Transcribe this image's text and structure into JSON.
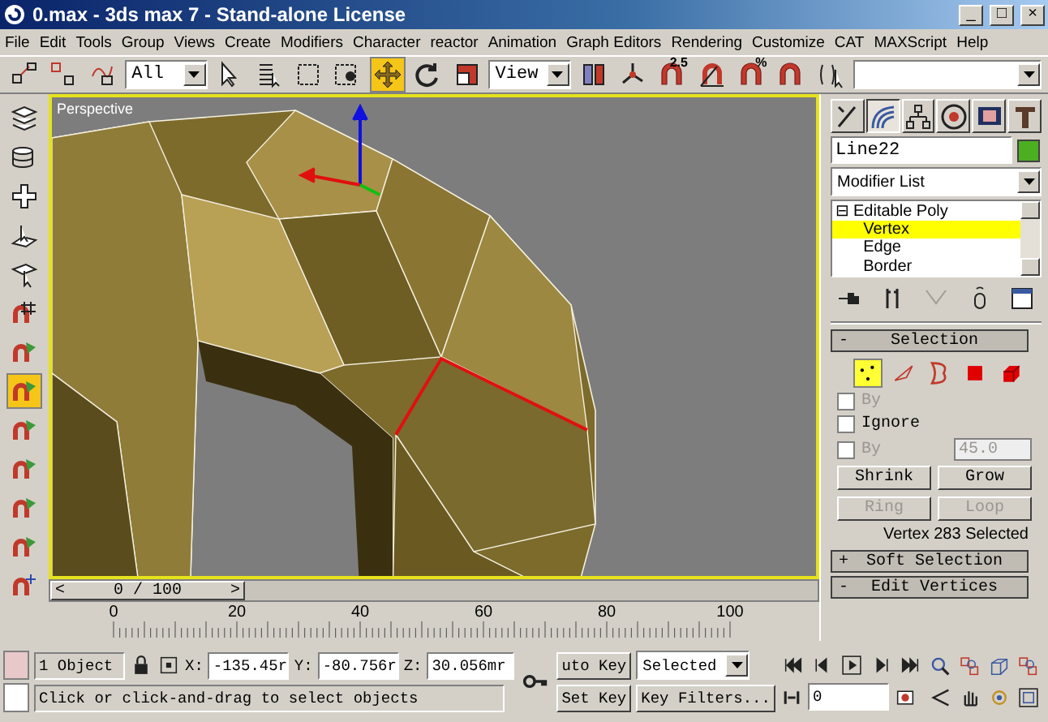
{
  "window": {
    "title": "0.max - 3ds max 7  - Stand-alone License"
  },
  "window_buttons": [
    "_",
    "□",
    "×"
  ],
  "menu": [
    "File",
    "Edit",
    "Tools",
    "Group",
    "Views",
    "Create",
    "Modifiers",
    "Character",
    "reactor",
    "Animation",
    "Graph Editors",
    "Rendering",
    "Customize",
    "CAT",
    "MAXScript",
    "Help"
  ],
  "main_toolbar": [
    {
      "kind": "tool",
      "selected": false
    },
    {
      "kind": "tool",
      "selected": false
    },
    {
      "kind": "tool",
      "selected": false
    },
    {
      "kind": "dropdown",
      "value": "All"
    },
    {
      "kind": "tool",
      "selected": false
    },
    {
      "kind": "tool",
      "selected": false
    },
    {
      "kind": "tool",
      "selected": false
    },
    {
      "kind": "tool",
      "selected": false
    },
    {
      "kind": "tool",
      "selected": true
    },
    {
      "kind": "tool",
      "selected": false
    },
    {
      "kind": "tool",
      "selected": false
    },
    {
      "kind": "dropdown",
      "value": "View"
    },
    {
      "kind": "tool",
      "selected": false
    },
    {
      "kind": "tool",
      "selected": false
    },
    {
      "kind": "tool",
      "selected": false,
      "badge": "2.5"
    },
    {
      "kind": "tool",
      "selected": false
    },
    {
      "kind": "tool",
      "selected": false,
      "badge": "%"
    },
    {
      "kind": "tool",
      "selected": false
    },
    {
      "kind": "tool",
      "selected": false
    },
    {
      "kind": "dropdown"
    }
  ],
  "left_toolbar": [
    {
      "selected": false
    },
    {
      "selected": false
    },
    {
      "selected": false
    },
    {
      "selected": false
    },
    {
      "selected": false
    },
    {
      "selected": false
    },
    {
      "selected": false
    },
    {
      "selected": true
    },
    {
      "selected": false
    },
    {
      "selected": false
    },
    {
      "selected": false
    },
    {
      "selected": false
    },
    {
      "selected": false
    }
  ],
  "viewport": {
    "label": "Perspective"
  },
  "command_panel": {
    "tabs": [
      {
        "selected": false
      },
      {
        "selected": true
      },
      {
        "selected": false
      },
      {
        "selected": false
      },
      {
        "selected": false
      },
      {
        "selected": false
      }
    ],
    "object": {
      "name": "Line22",
      "color": "#4caf22"
    },
    "modifier_list": "Modifier List",
    "stack": [
      {
        "label": "Editable Poly",
        "sign": "⊟",
        "selected": false,
        "children": [
          {
            "label": "Vertex",
            "selected": true
          },
          {
            "label": "Edge",
            "selected": false
          },
          {
            "label": "Border",
            "selected": false
          }
        ]
      }
    ],
    "stack_tools": [
      {
        "disabled": false
      },
      {
        "disabled": false
      },
      {
        "disabled": true
      },
      {
        "disabled": false
      },
      {
        "disabled": false
      }
    ],
    "rollouts": [
      {
        "sign": "-",
        "title": "Selection",
        "kind": "selection"
      },
      {
        "sign": "+",
        "title": "Soft Selection",
        "kind": "header"
      },
      {
        "sign": "-",
        "title": "Edit Vertices",
        "kind": "header"
      }
    ],
    "subobjects": [
      {
        "selected": true
      },
      {
        "selected": false
      },
      {
        "selected": false
      },
      {
        "selected": false
      },
      {
        "selected": false
      }
    ],
    "options": [
      {
        "label": "By",
        "checked": false,
        "disabled": true
      },
      {
        "label": "Ignore",
        "checked": false,
        "disabled": false
      },
      {
        "label": "By",
        "checked": false,
        "disabled": true,
        "value": "45.0"
      }
    ],
    "buttons": [
      {
        "label": "Shrink",
        "disabled": false
      },
      {
        "label": "Grow",
        "disabled": false
      },
      {
        "label": "Ring",
        "disabled": true
      },
      {
        "label": "Loop",
        "disabled": true
      }
    ],
    "selection_info": "Vertex 283 Selected"
  },
  "time_slider": {
    "prev": "<",
    "label": "0 / 100",
    "next": ">",
    "level": 0
  },
  "ruler": [
    "0",
    "20",
    "40",
    "60",
    "80",
    "100"
  ],
  "status": {
    "selection": "1 Object",
    "x_label": "X:",
    "x": "-135.45r",
    "y_label": "Y:",
    "y": "-80.756r",
    "z_label": "Z:",
    "z": "30.056mr",
    "prompt": "Click or click-and-drag to select objects"
  },
  "keys": {
    "auto_key": "uto Key",
    "set_key": "Set Key",
    "key_mode": "Selected",
    "key_filters": "Key Filters...",
    "frame": "0"
  }
}
